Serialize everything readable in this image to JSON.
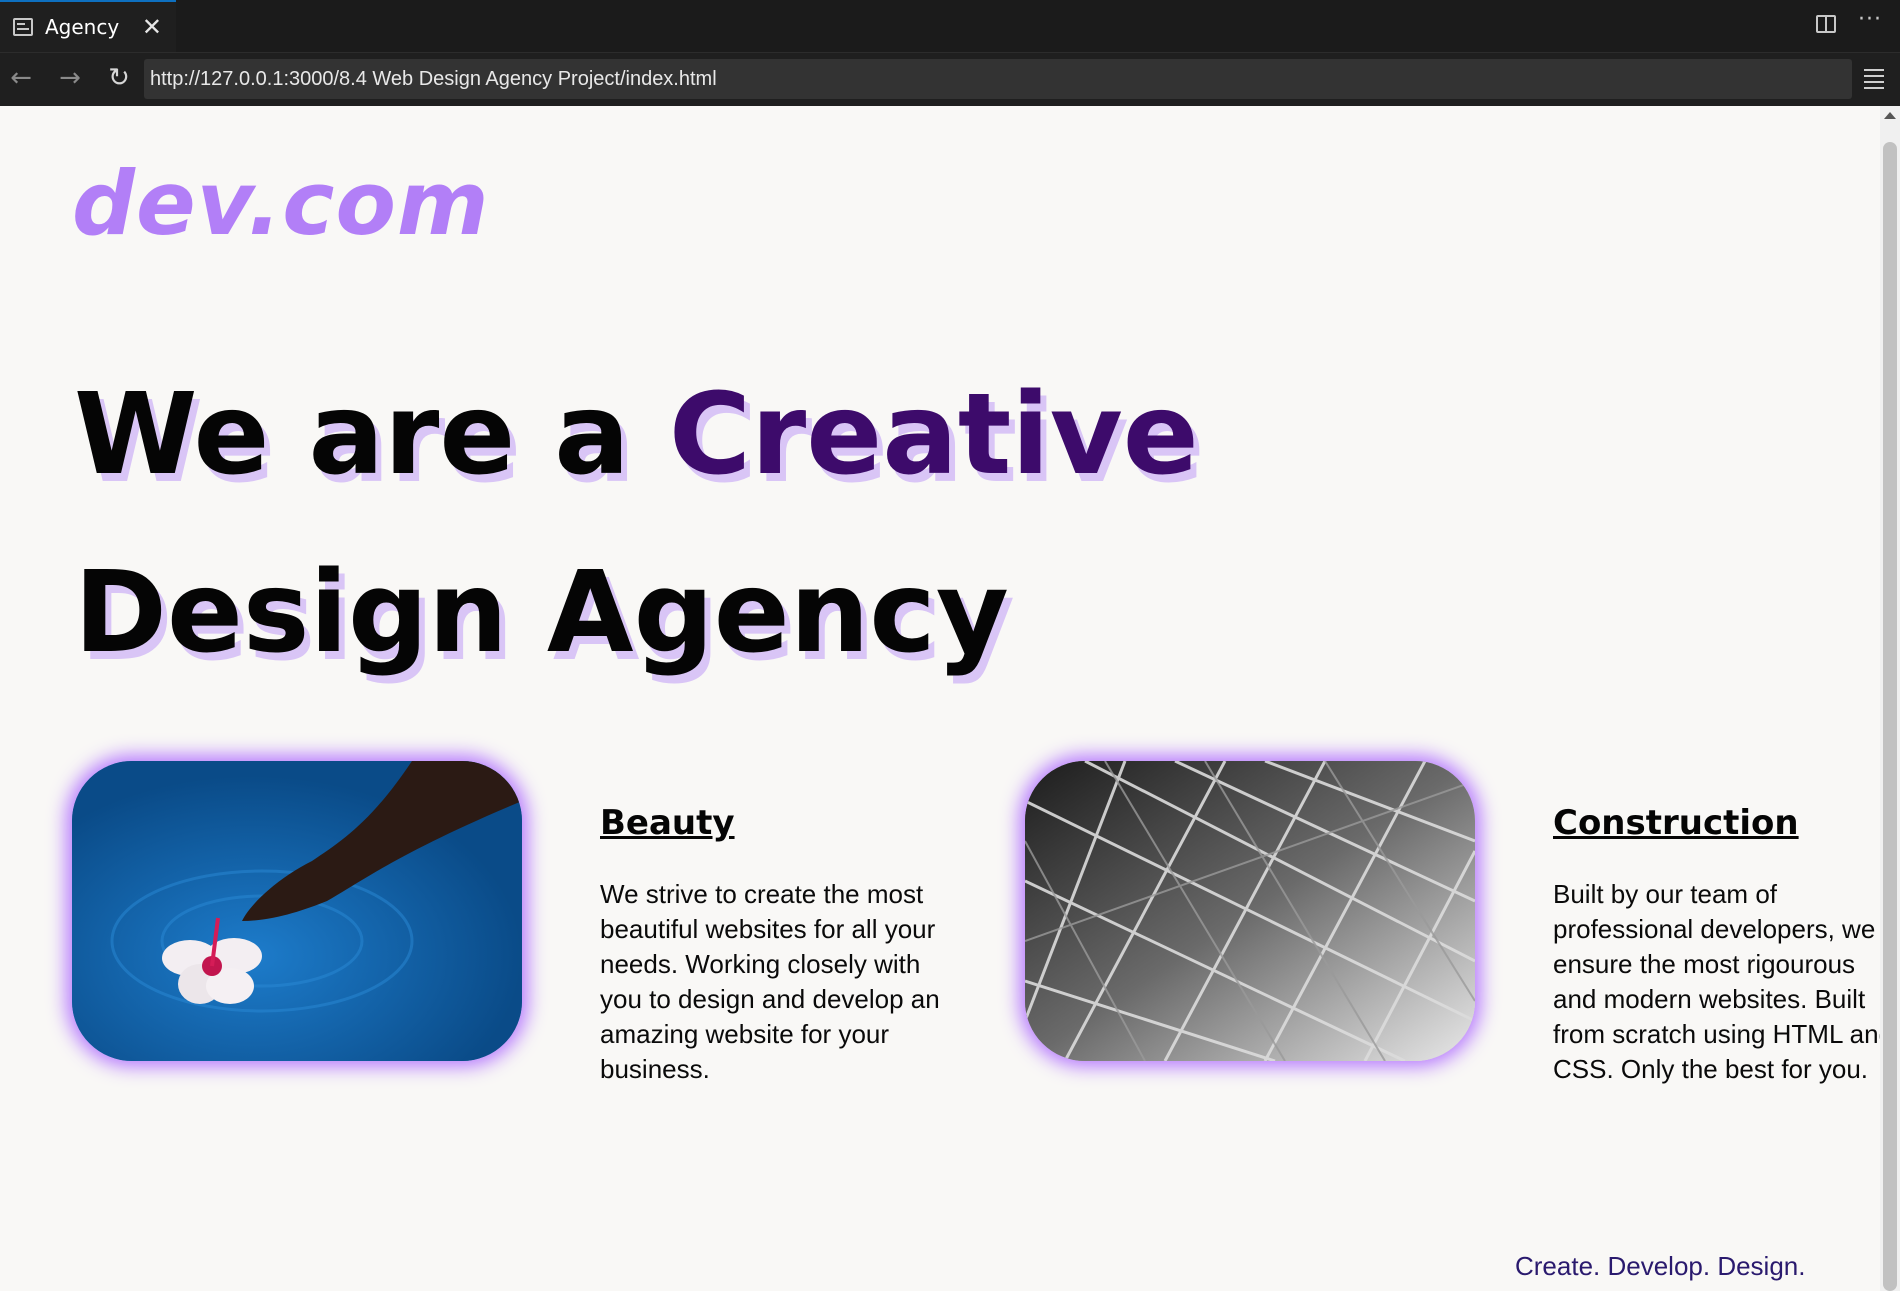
{
  "browser": {
    "tab_title": "Agency",
    "url": "http://127.0.0.1:3000/8.4 Web Design Agency Project/index.html",
    "icons": [
      "page-icon",
      "close-icon",
      "split-view-icon",
      "more-icon",
      "back-icon",
      "forward-icon",
      "reload-icon",
      "menu-icon"
    ]
  },
  "page": {
    "logo": "dev.com",
    "hero": {
      "line1_prefix": "We are a ",
      "line1_accent": "Creative",
      "line2": "Design Agency"
    },
    "cards": [
      {
        "title": "Beauty",
        "text": "We strive to create the most beautiful websites for all your needs. Working closely with you to design and develop an amazing website for your business.",
        "image_alt": "hand placing flower on water"
      },
      {
        "title": "Construction",
        "text": "Built by our team of professional developers, we ensure the most rigourous and modern websites. Built from scratch using HTML and CSS. Only the best for you.",
        "image_alt": "steel structure"
      }
    ],
    "tagline": "Create. Develop. Design."
  },
  "colors": {
    "logo": "#b27ff7",
    "accent": "#3d0b6b",
    "hero_shadow": "#d9c5f6",
    "image_glow": "#ab66ff",
    "background": "#f9f8f6"
  }
}
